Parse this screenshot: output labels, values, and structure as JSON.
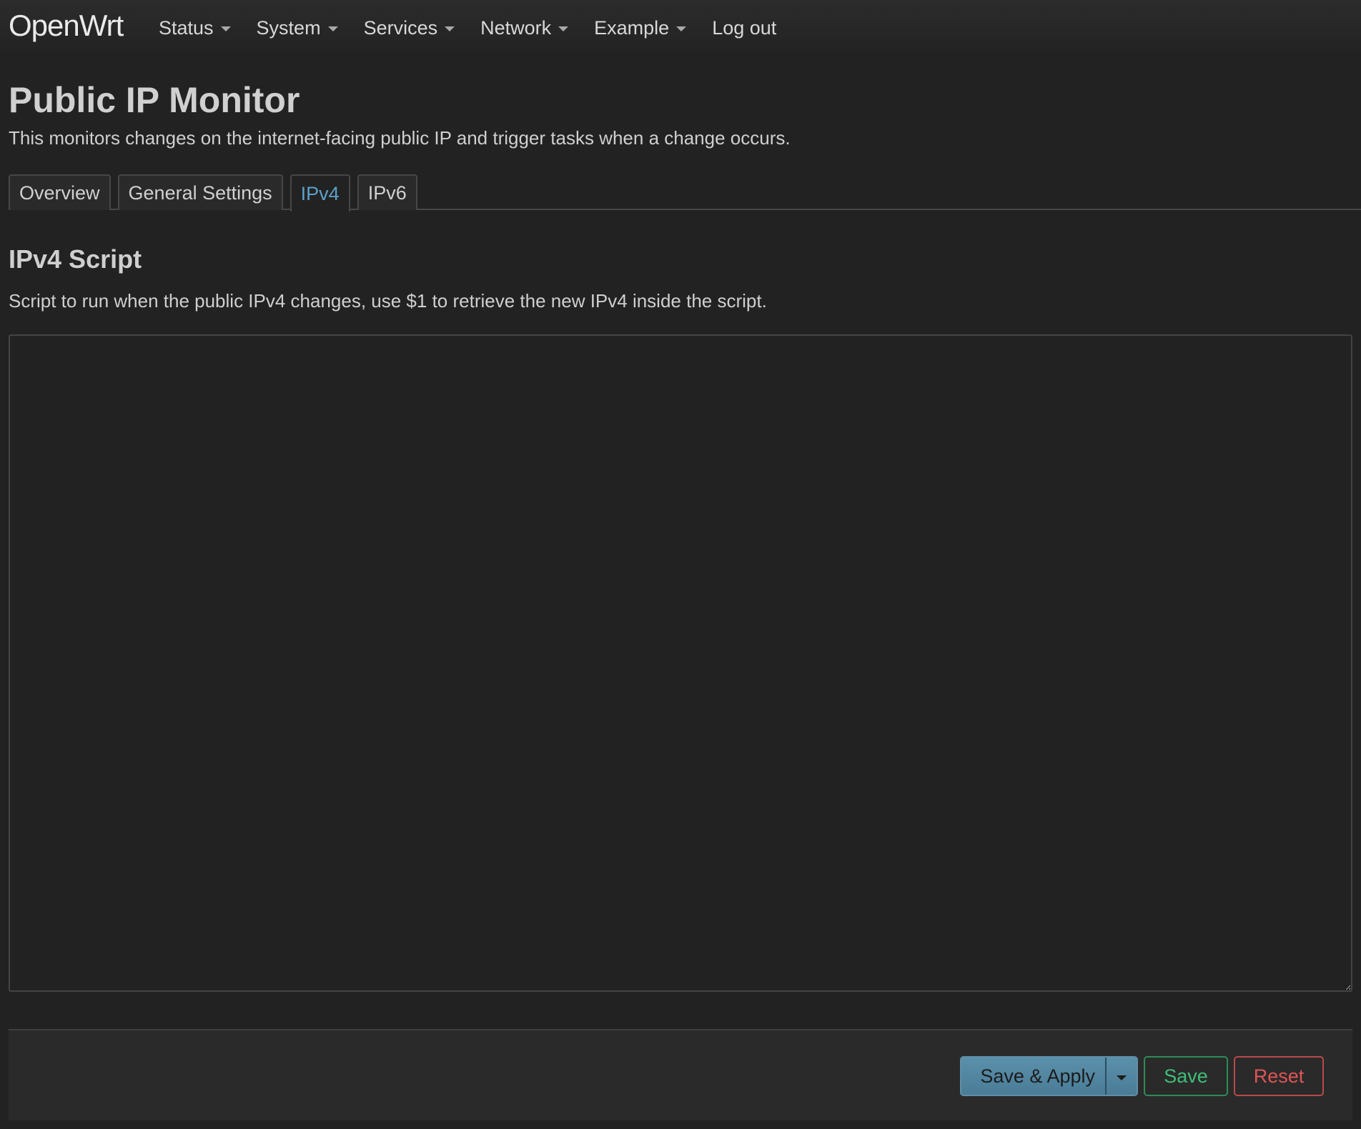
{
  "header": {
    "brand": "OpenWrt",
    "nav": [
      {
        "label": "Status",
        "has_dropdown": true
      },
      {
        "label": "System",
        "has_dropdown": true
      },
      {
        "label": "Services",
        "has_dropdown": true
      },
      {
        "label": "Network",
        "has_dropdown": true
      },
      {
        "label": "Example",
        "has_dropdown": true
      },
      {
        "label": "Log out",
        "has_dropdown": false
      }
    ]
  },
  "page": {
    "title": "Public IP Monitor",
    "description": "This monitors changes on the internet-facing public IP and trigger tasks when a change occurs."
  },
  "tabs": [
    {
      "label": "Overview",
      "active": false
    },
    {
      "label": "General Settings",
      "active": false
    },
    {
      "label": "IPv4",
      "active": true
    },
    {
      "label": "IPv6",
      "active": false
    }
  ],
  "section": {
    "title": "IPv4 Script",
    "description": "Script to run when the public IPv4 changes, use $1 to retrieve the new IPv4 inside the script.",
    "script_value": ""
  },
  "footer": {
    "save_apply_label": "Save & Apply",
    "save_label": "Save",
    "reset_label": "Reset"
  },
  "colors": {
    "background": "#222222",
    "active_tab": "#5ba0c8",
    "save_apply": "#4e8099",
    "save": "#3fbf78",
    "reset": "#e05555"
  },
  "icons": {
    "dropdown": "caret-down-icon"
  }
}
